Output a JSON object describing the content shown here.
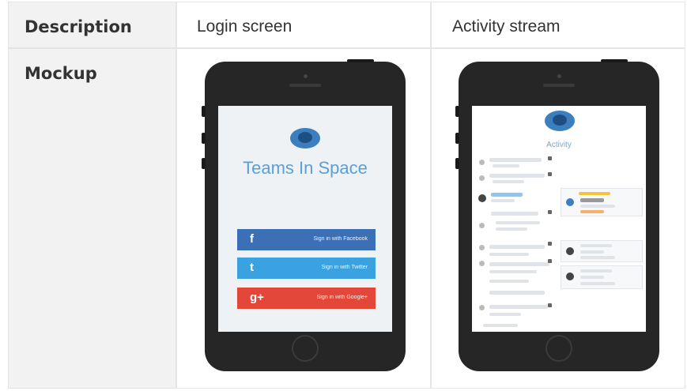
{
  "table": {
    "header": {
      "label": "Description",
      "columns": [
        "Login screen",
        "Activity stream"
      ]
    },
    "row": {
      "label": "Mockup"
    }
  },
  "login_mockup": {
    "app_title": "Teams In Space",
    "buttons": [
      {
        "glyph": "f",
        "label": "Sign in with Facebook",
        "color": "#3b6fb6"
      },
      {
        "glyph": "t",
        "label": "Sign in with Twitter",
        "color": "#3aa2e0"
      },
      {
        "glyph": "g+",
        "label": "Sign in with Google+",
        "color": "#e2473a"
      }
    ]
  },
  "activity_mockup": {
    "title": "Activity"
  },
  "colors": {
    "header_bg": "#f2f2f2",
    "phone_body": "#262626",
    "brand_blue": "#5aa0d8"
  }
}
